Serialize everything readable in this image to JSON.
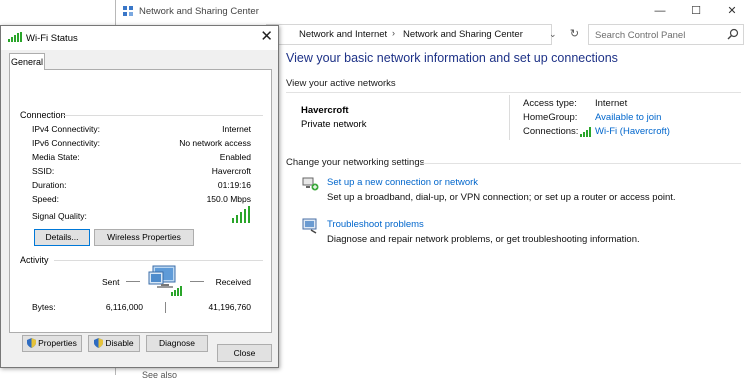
{
  "nsc": {
    "title": "Network and Sharing Center",
    "breadcrumbs": [
      "Network and Internet",
      "Network and Sharing Center"
    ],
    "search_placeholder": "Search Control Panel",
    "heading": "View your basic network information and set up connections",
    "active_networks_label": "View your active networks",
    "network": {
      "name": "Havercroft",
      "type": "Private network",
      "access_type_label": "Access type:",
      "access_type_value": "Internet",
      "homegroup_label": "HomeGroup:",
      "homegroup_value": "Available to join",
      "connections_label": "Connections:",
      "connections_value": "Wi-Fi (Havercroft)"
    },
    "change_settings_label": "Change your networking settings",
    "tasks": [
      {
        "link": "Set up a new connection or network",
        "desc": "Set up a broadband, dial-up, or VPN connection; or set up a router or access point."
      },
      {
        "link": "Troubleshoot problems",
        "desc": "Diagnose and repair network problems, or get troubleshooting information."
      }
    ],
    "bottom_partial": "See also"
  },
  "wifi": {
    "title": "Wi-Fi Status",
    "tab": "General",
    "connection_label": "Connection",
    "rows": [
      {
        "label": "IPv4 Connectivity:",
        "value": "Internet"
      },
      {
        "label": "IPv6 Connectivity:",
        "value": "No network access"
      },
      {
        "label": "Media State:",
        "value": "Enabled"
      },
      {
        "label": "SSID:",
        "value": "Havercroft"
      },
      {
        "label": "Duration:",
        "value": "01:19:16"
      },
      {
        "label": "Speed:",
        "value": "150.0 Mbps"
      }
    ],
    "signal_label": "Signal Quality:",
    "signal_bars": 5,
    "details_button": "Details...",
    "wireless_properties_button": "Wireless Properties",
    "activity_label": "Activity",
    "sent_label": "Sent",
    "received_label": "Received",
    "bytes_label": "Bytes:",
    "bytes_sent": "6,116,000",
    "bytes_received": "41,196,760",
    "properties_button": "Properties",
    "disable_button": "Disable",
    "diagnose_button": "Diagnose",
    "close_button": "Close"
  },
  "colors": {
    "link": "#0066cc",
    "heading": "#1e3287",
    "signal_green": "#2aa52a",
    "focus_border": "#0078d7"
  },
  "icons": [
    "network-center-icon",
    "search-icon",
    "refresh-icon",
    "wifi-signal-icon",
    "close-icon",
    "shield-icon",
    "computer-network-icon",
    "new-connection-icon",
    "troubleshoot-icon"
  ]
}
